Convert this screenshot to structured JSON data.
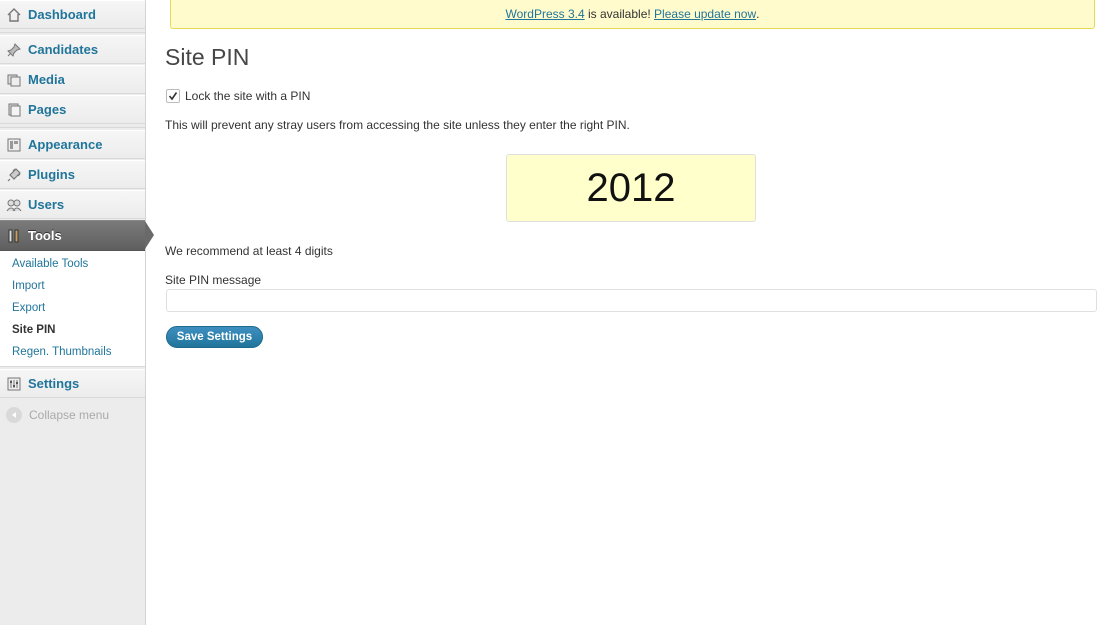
{
  "notice": {
    "link1": "WordPress 3.4",
    "middle": " is available! ",
    "link2": "Please update now",
    "end": "."
  },
  "sidebar": {
    "items": [
      {
        "label": "Dashboard",
        "icon": "dashboard-icon"
      },
      {
        "label": "Candidates",
        "icon": "pushpin-icon"
      },
      {
        "label": "Media",
        "icon": "media-icon"
      },
      {
        "label": "Pages",
        "icon": "pages-icon"
      },
      {
        "label": "Appearance",
        "icon": "appearance-icon"
      },
      {
        "label": "Plugins",
        "icon": "plugin-icon"
      },
      {
        "label": "Users",
        "icon": "users-icon"
      },
      {
        "label": "Tools",
        "icon": "tools-icon",
        "current": true
      },
      {
        "label": "Settings",
        "icon": "settings-icon"
      }
    ],
    "submenu": [
      {
        "label": "Available Tools"
      },
      {
        "label": "Import"
      },
      {
        "label": "Export"
      },
      {
        "label": "Site PIN",
        "active": true
      },
      {
        "label": "Regen. Thumbnails"
      }
    ],
    "collapse_label": "Collapse menu"
  },
  "main": {
    "title": "Site PIN",
    "lock_label": "Lock the site with a PIN",
    "lock_checked": true,
    "description": "This will prevent any stray users from accessing the site unless they enter the right PIN.",
    "pin_value": "2012",
    "recommend": "We recommend at least 4 digits",
    "message_label": "Site PIN message",
    "message_value": "",
    "save_label": "Save Settings"
  },
  "colors": {
    "link": "#21759b",
    "notice_bg": "#fffbcc",
    "pin_bg": "#ffffcc",
    "button": "#21759b"
  }
}
